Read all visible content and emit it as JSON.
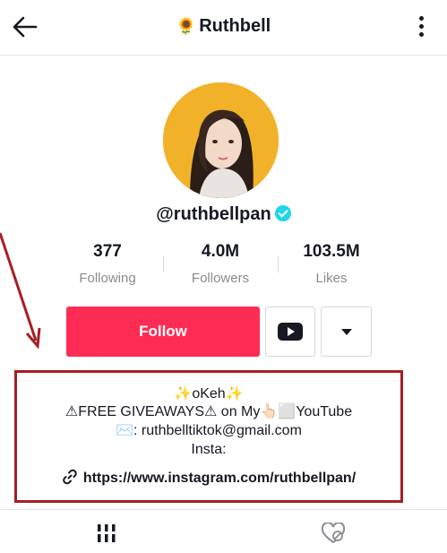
{
  "header": {
    "title_emoji": "🌻",
    "title": "Ruthbell",
    "back_icon": "arrow-left-icon",
    "more_icon": "vertical-dots-icon"
  },
  "profile": {
    "username": "@ruthbellpan",
    "verified": true
  },
  "stats": [
    {
      "value": "377",
      "label": "Following"
    },
    {
      "value": "4.0M",
      "label": "Followers"
    },
    {
      "value": "103.5M",
      "label": "Likes"
    }
  ],
  "actions": {
    "follow_label": "Follow",
    "youtube_icon": "youtube-icon",
    "dropdown_icon": "triangle-down-icon"
  },
  "bio": {
    "line1": "✨oKeh✨",
    "line2": "⚠FREE GIVEAWAYS⚠ on My👆🏻⬜YouTube",
    "line3": "✉️: ruthbelltiktok@gmail.com",
    "line4": "Insta:",
    "link": "https://www.instagram.com/ruthbellpan/"
  },
  "tabs": {
    "videos_icon": "grid-icon",
    "liked_icon": "hidden-heart-icon"
  },
  "colors": {
    "follow": "#fe2c55",
    "annotation": "#a61e22",
    "verified": "#20d5ec",
    "avatar_ring": "#f1b22a"
  }
}
